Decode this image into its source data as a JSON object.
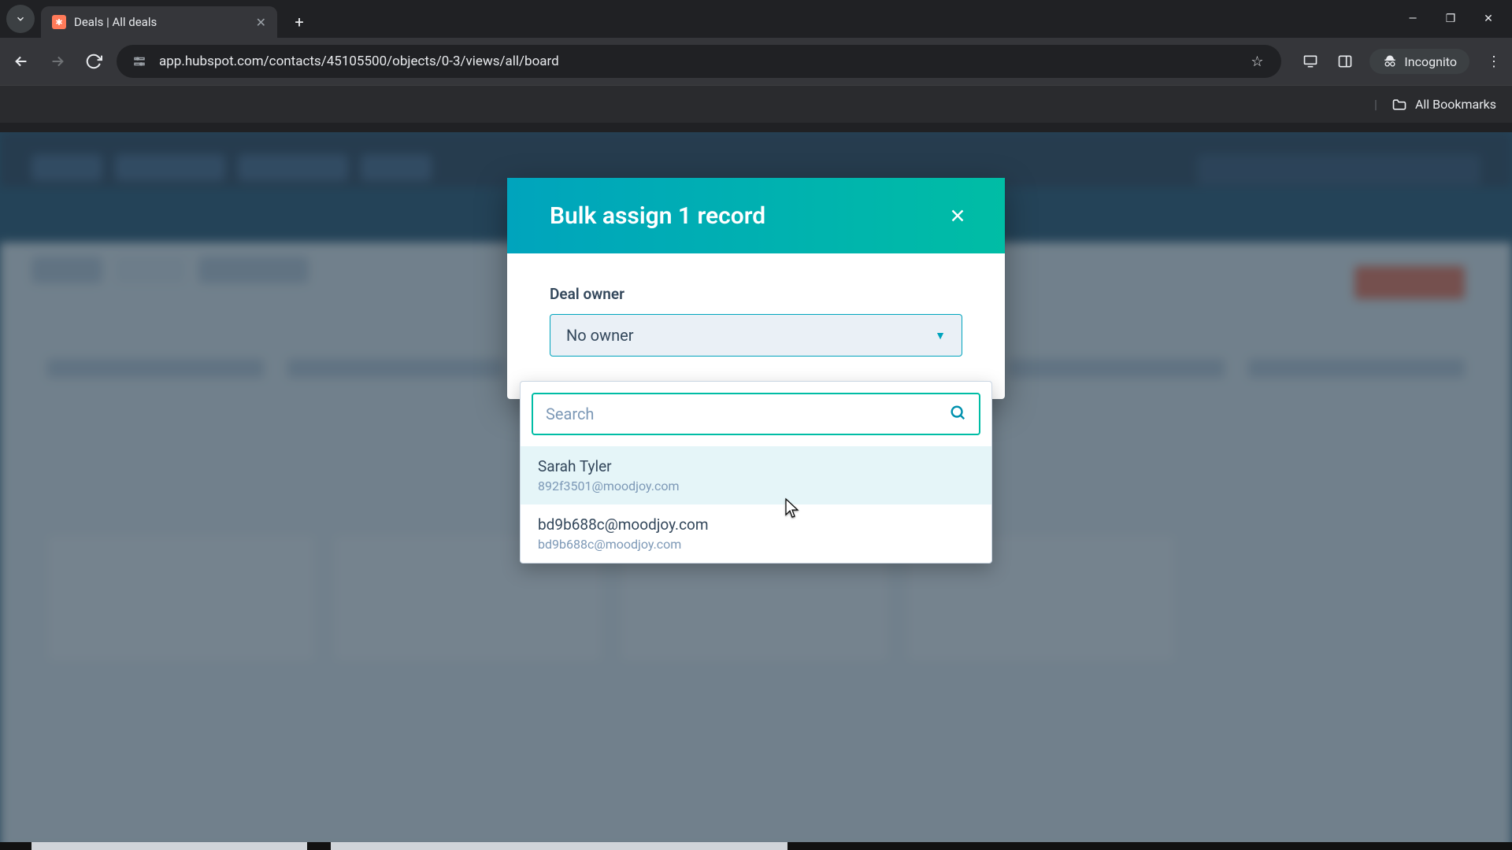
{
  "browser": {
    "tab_title": "Deals | All deals",
    "url": "app.hubspot.com/contacts/45105500/objects/0-3/views/all/board",
    "incognito_label": "Incognito",
    "bookmarks_label": "All Bookmarks"
  },
  "modal": {
    "title": "Bulk assign 1 record",
    "field_label": "Deal owner",
    "select_value": "No owner",
    "search_placeholder": "Search",
    "options": [
      {
        "name": "Sarah Tyler",
        "email": "892f3501@moodjoy.com"
      },
      {
        "name": "bd9b688c@moodjoy.com",
        "email": "bd9b688c@moodjoy.com"
      }
    ]
  }
}
